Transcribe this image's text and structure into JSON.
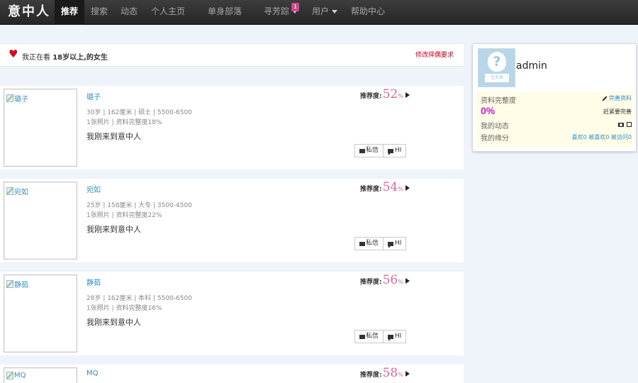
{
  "nav": {
    "brand": "意中人",
    "items": [
      {
        "label": "推荐",
        "active": true
      },
      {
        "label": "搜索"
      },
      {
        "label": "动态"
      },
      {
        "label": "个人主页"
      },
      {
        "label": "单身部落"
      },
      {
        "label": "寻芳踪",
        "badge": "1"
      },
      {
        "label": "用户"
      },
      {
        "label": "帮助中心"
      }
    ]
  },
  "filter": {
    "prefix": "我正在看",
    "criteria": "18岁以上,的女生",
    "edit_label": "修改择偶要求"
  },
  "cards": [
    {
      "name": "璐子",
      "alt": "璐子",
      "details": "30岁 | 162厘米 | 硕士 | 5500-6500",
      "photos": "1张照片 | 资料完整度18%",
      "intro": "我刚来到意中人",
      "score": "52"
    },
    {
      "name": "宛如",
      "alt": "宛如",
      "details": "25岁 | 158厘米 | 大专 | 3500-4500",
      "photos": "1张照片 | 资料完整度22%",
      "intro": "我刚来到意中人",
      "score": "54"
    },
    {
      "name": "静茹",
      "alt": "静茹",
      "details": "28岁 | 162厘米 | 本科 | 5500-6500",
      "photos": "1张照片 | 资料完整度16%",
      "intro": "我刚来到意中人",
      "score": "56"
    },
    {
      "name": "MQ",
      "alt": "MQ",
      "details": "",
      "photos": "",
      "intro": "",
      "score": "58"
    }
  ],
  "card_labels": {
    "score_label": "推荐度:",
    "percent": "%",
    "message": "私信",
    "hi": "HI"
  },
  "profile": {
    "username": "admin",
    "avatar_text": "主页君",
    "completeness_label": "资料完整度",
    "complete_link": "完善资料",
    "completeness_value": "0%",
    "hint": "赶紧要完善",
    "activity_label": "我的动态",
    "fate_label": "我的缘分",
    "likes": "喜欢0",
    "liked": "被喜欢0",
    "visited": "被访问0"
  }
}
